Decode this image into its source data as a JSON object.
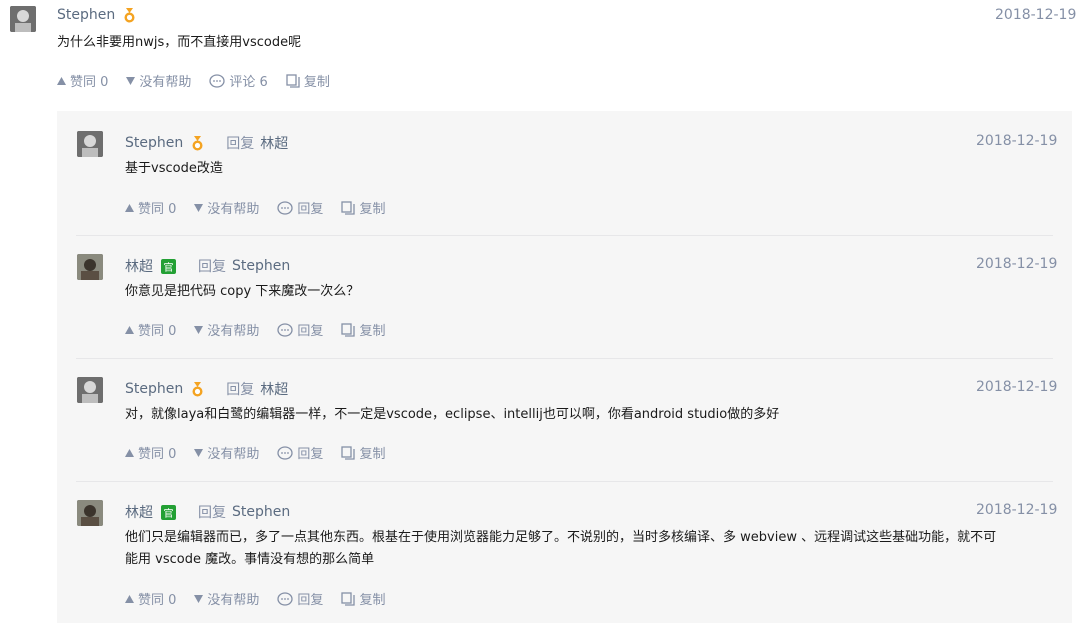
{
  "top": {
    "author": "Stephen",
    "date": "2018-12-19",
    "content": "为什么非要用nwjs，而不直接用vscode呢",
    "actions": {
      "agree": "赞同 0",
      "disagree": "没有帮助",
      "comment": "评论 6",
      "copy": "复制"
    }
  },
  "reply_labels": {
    "reply": "回复",
    "agree": "赞同 0",
    "disagree": "没有帮助",
    "reply_action": "回复",
    "copy": "复制"
  },
  "badges": {
    "official": "官"
  },
  "replies": [
    {
      "author": "Stephen",
      "target": "林超",
      "date": "2018-12-19",
      "content": "基于vscode改造"
    },
    {
      "author": "林超",
      "target": "Stephen",
      "date": "2018-12-19",
      "content": "你意见是把代码 copy 下来魔改一次么？"
    },
    {
      "author": "Stephen",
      "target": "林超",
      "date": "2018-12-19",
      "content": "对，就像laya和白鹭的编辑器一样，不一定是vscode，eclipse、intellij也可以啊，你看android studio做的多好"
    },
    {
      "author": "林超",
      "target": "Stephen",
      "date": "2018-12-19",
      "content_line1": "他们只是编辑器而已，多了一点其他东西。根基在于使用浏览器能力足够了。不说别的，当时多核编译、多 webview 、远程调试这些基础功能，就不可",
      "content_line2": "能用 vscode 魔改。事情没有想的那么简单"
    }
  ],
  "colors": {
    "link": "#5b6b80",
    "meta": "#8590a6",
    "official": "#23a034",
    "gold": "#f4a321",
    "panel": "#f6f6f6"
  },
  "icons": [
    "up-triangle-icon",
    "down-triangle-icon",
    "comment-bubble-icon",
    "copy-icon",
    "gold-medal-icon",
    "official-badge"
  ]
}
